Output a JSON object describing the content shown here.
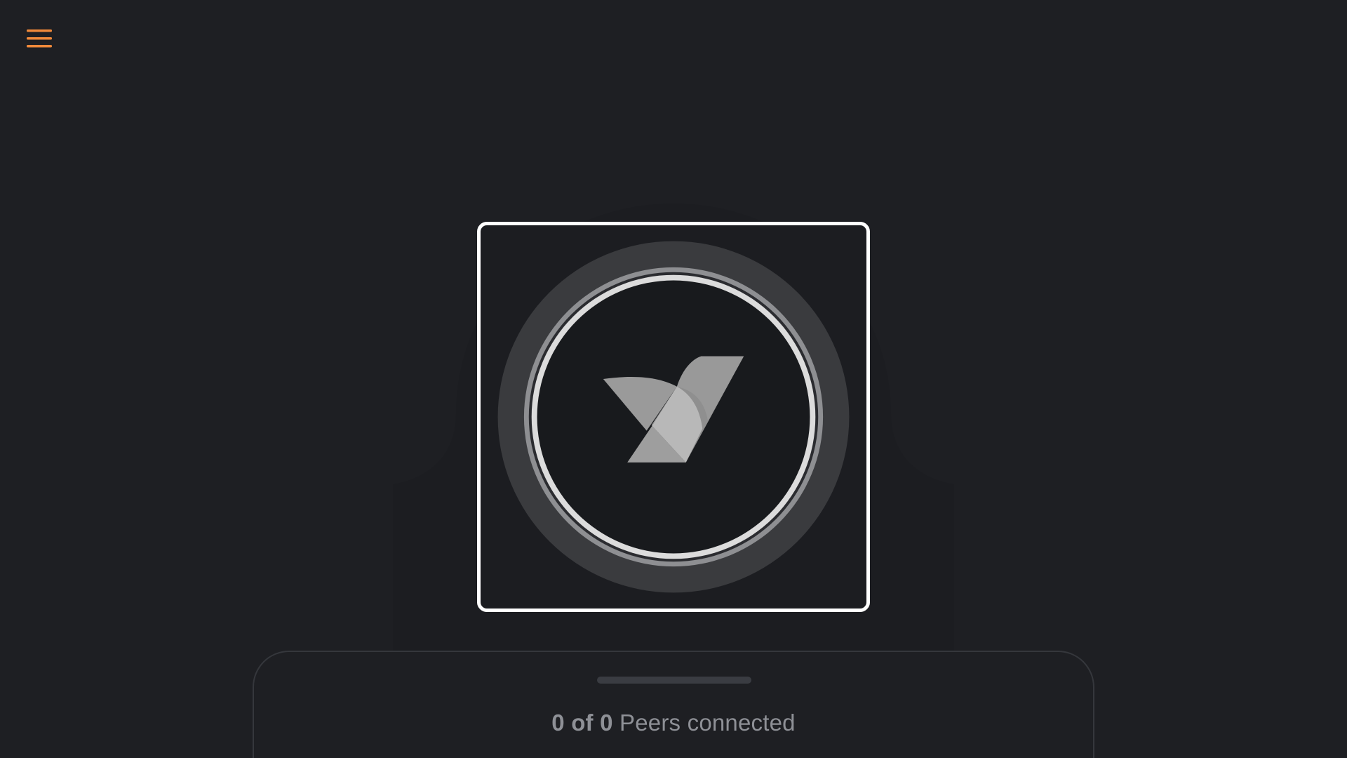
{
  "header": {
    "menu_icon": "hamburger-menu-icon",
    "accent_color": "#f0893a"
  },
  "connect": {
    "logo_icon": "bird-logo-icon",
    "status": "disconnected",
    "frame_color": "#ffffff"
  },
  "sheet": {
    "peers_count": "0 of 0",
    "peers_label": " Peers connected"
  },
  "colors": {
    "background": "#1e1f23",
    "text_muted": "#8e9096"
  }
}
